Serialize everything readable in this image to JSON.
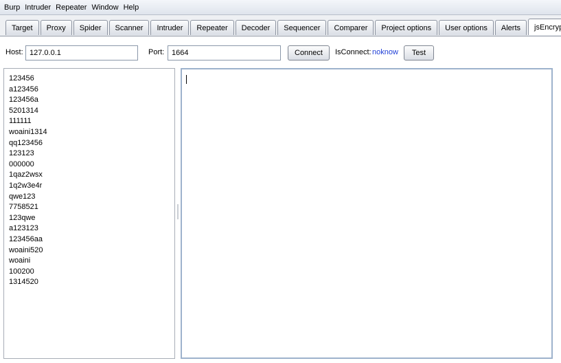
{
  "menu": [
    "Burp",
    "Intruder",
    "Repeater",
    "Window",
    "Help"
  ],
  "tabs": [
    "Target",
    "Proxy",
    "Spider",
    "Scanner",
    "Intruder",
    "Repeater",
    "Decoder",
    "Sequencer",
    "Comparer",
    "Project options",
    "User options",
    "Alerts",
    "jsEncrypter"
  ],
  "active_tab": "jsEncrypter",
  "toolbar": {
    "host_label": "Host:",
    "host_value": "127.0.0.1",
    "port_label": "Port:",
    "port_value": "1664",
    "connect_label": "Connect",
    "isconnect_label": "IsConnect:",
    "isconnect_value": "noknow",
    "test_label": "Test"
  },
  "payloads": [
    "123456",
    "a123456",
    "123456a",
    "5201314",
    "111111",
    "woaini1314",
    "qq123456",
    "123123",
    "000000",
    "1qaz2wsx",
    "1q2w3e4r",
    "qwe123",
    "7758521",
    "123qwe",
    "a123123",
    "123456aa",
    "woaini520",
    "woaini",
    "100200",
    "1314520"
  ],
  "editor_text": "",
  "colors": {
    "status_value": "#1e3ed6",
    "editor_border": "#9db2cc"
  }
}
